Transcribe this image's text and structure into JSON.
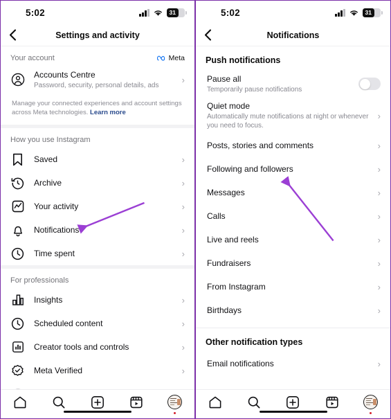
{
  "status_bar": {
    "time": "5:02",
    "signal_icon": "cellular-signal-icon",
    "wifi_icon": "wifi-icon",
    "battery_level": "31"
  },
  "left_screen": {
    "nav": {
      "back_icon": "back-chevron-icon",
      "title": "Settings and activity"
    },
    "account_section": {
      "header": "Your account",
      "brand": "Meta",
      "brand_icon": "meta-infinity-icon",
      "row": {
        "icon": "accounts-centre-icon",
        "label": "Accounts Centre",
        "sub": "Password, security, personal details, ads",
        "chevron": "›"
      },
      "note_text": "Manage your connected experiences and account settings across Meta technologies. ",
      "note_link": "Learn more"
    },
    "usage_section": {
      "header": "How you use Instagram",
      "items": [
        {
          "label": "Saved",
          "icon": "bookmark-icon",
          "chevron": "›"
        },
        {
          "label": "Archive",
          "icon": "archive-clock-icon",
          "chevron": "›"
        },
        {
          "label": "Your activity",
          "icon": "activity-chart-icon",
          "chevron": "›"
        },
        {
          "label": "Notifications",
          "icon": "bell-icon",
          "chevron": "›"
        },
        {
          "label": "Time spent",
          "icon": "clock-icon",
          "chevron": "›"
        }
      ]
    },
    "professional_section": {
      "header": "For professionals",
      "items": [
        {
          "label": "Insights",
          "icon": "insights-bar-icon",
          "chevron": "›"
        },
        {
          "label": "Scheduled content",
          "icon": "clock-icon",
          "chevron": "›"
        },
        {
          "label": "Creator tools and controls",
          "icon": "creator-tools-icon",
          "chevron": "›"
        },
        {
          "label": "Meta Verified",
          "icon": "meta-verified-badge-icon",
          "chevron": "›"
        }
      ]
    }
  },
  "right_screen": {
    "nav": {
      "back_icon": "back-chevron-icon",
      "title": "Notifications"
    },
    "push_section": {
      "header": "Push notifications",
      "pause_all": {
        "label": "Pause all",
        "sub": "Temporarily pause notifications",
        "toggle_state": "off"
      },
      "quiet_mode": {
        "label": "Quiet mode",
        "sub": "Automatically mute notifications at night or whenever you need to focus.",
        "chevron": "›"
      },
      "items": [
        {
          "label": "Posts, stories and comments",
          "chevron": "›"
        },
        {
          "label": "Following and followers",
          "chevron": "›"
        },
        {
          "label": "Messages",
          "chevron": "›"
        },
        {
          "label": "Calls",
          "chevron": "›"
        },
        {
          "label": "Live and reels",
          "chevron": "›"
        },
        {
          "label": "Fundraisers",
          "chevron": "›"
        },
        {
          "label": "From Instagram",
          "chevron": "›"
        },
        {
          "label": "Birthdays",
          "chevron": "›"
        }
      ]
    },
    "other_section": {
      "header": "Other notification types",
      "items": [
        {
          "label": "Email notifications",
          "chevron": "›"
        }
      ]
    }
  },
  "tab_bar": {
    "tabs": [
      {
        "name": "home-icon"
      },
      {
        "name": "search-icon"
      },
      {
        "name": "create-plus-icon"
      },
      {
        "name": "reels-icon"
      },
      {
        "name": "profile-avatar"
      }
    ]
  },
  "annotations": {
    "arrow_color": "#9b3fd4",
    "arrow_left_target": "Notifications",
    "arrow_right_target": "Following and followers"
  }
}
